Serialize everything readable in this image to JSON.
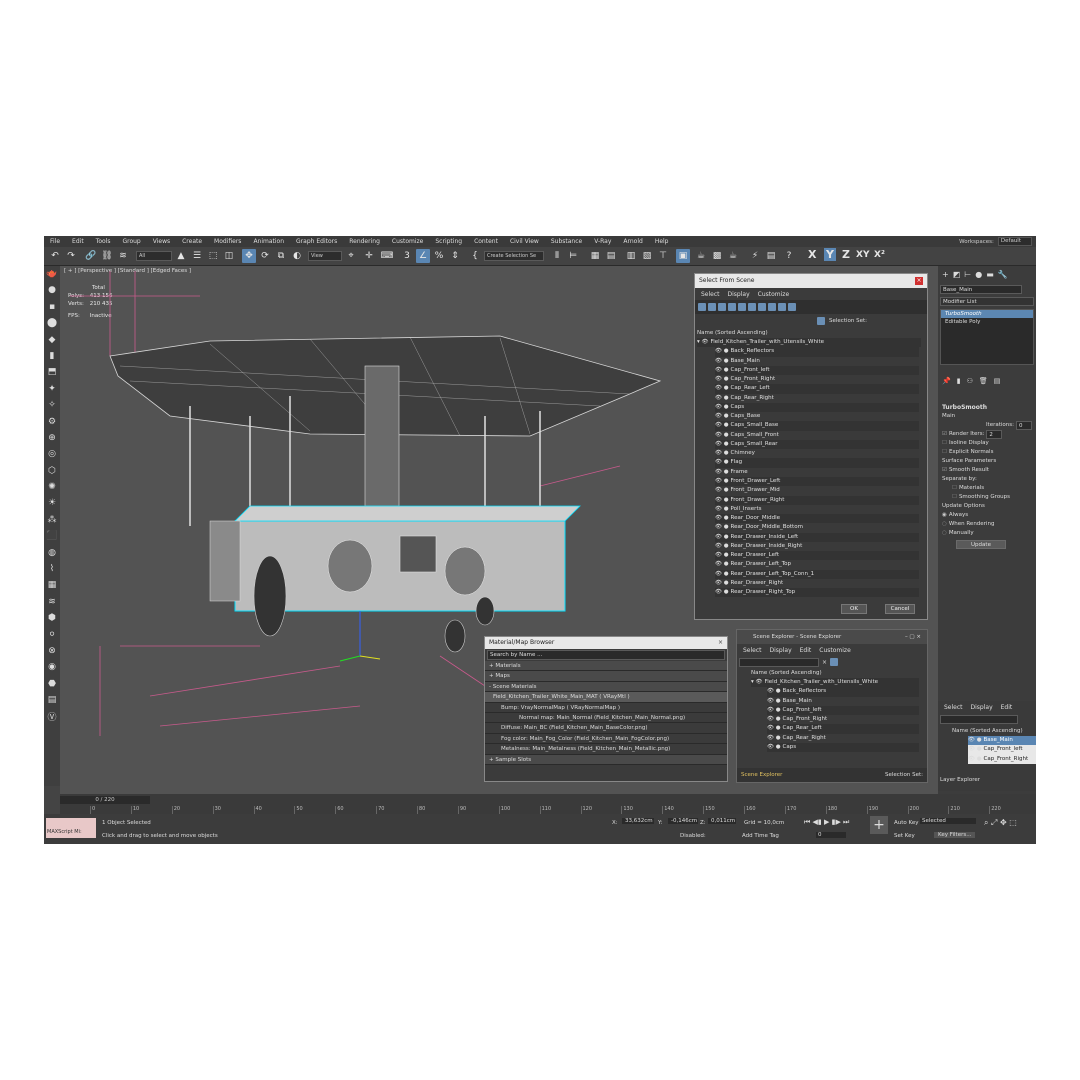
{
  "menu": [
    "File",
    "Edit",
    "Tools",
    "Group",
    "Views",
    "Create",
    "Modifiers",
    "Animation",
    "Graph Editors",
    "Rendering",
    "Customize",
    "Scripting",
    "Content",
    "Civil View",
    "Substance",
    "V-Ray",
    "Arnold",
    "Help"
  ],
  "workspace": {
    "label": "Workspaces:",
    "value": "Default"
  },
  "toolbar": {
    "filter": "All",
    "view": "View",
    "selection_set": "Create Selection Se",
    "axes": [
      "X",
      "Y",
      "Z",
      "XY",
      "X²"
    ]
  },
  "viewport": {
    "label": "[ + ] [Perspective ] [Standard ] [Edged Faces ]",
    "total": "Total",
    "polys_label": "Polys:",
    "polys": "413 156",
    "verts_label": "Verts:",
    "verts": "210 435",
    "fps_label": "FPS:",
    "fps": "Inactive"
  },
  "right_panel": {
    "object_name": "Base_Main",
    "modifier_list": "Modifier List",
    "stack": [
      "TurboSmooth",
      "Editable Poly"
    ],
    "turbosmooth": {
      "title": "TurboSmooth",
      "main": "Main",
      "iterations_label": "Iterations:",
      "iterations": "0",
      "render_iters_label": "Render Iters:",
      "render_iters": "2",
      "isoline": "Isoline Display",
      "explicit": "Explicit Normals",
      "surface": "Surface Parameters",
      "smooth": "Smooth Result",
      "separate": "Separate by:",
      "materials": "Materials",
      "smoothing": "Smoothing Groups",
      "update_opts": "Update Options",
      "always": "Always",
      "when_render": "When Rendering",
      "manually": "Manually",
      "update_btn": "Update"
    }
  },
  "select_from_scene": {
    "title": "Select From Scene",
    "menu": [
      "Select",
      "Display",
      "Customize"
    ],
    "selection_set": "Selection Set:",
    "header": "Name (Sorted Ascending)",
    "root": "Field_Kitchen_Trailer_with_Utensils_White",
    "items": [
      "Back_Reflectors",
      "Base_Main",
      "Cap_Front_left",
      "Cap_Front_Right",
      "Cap_Rear_Left",
      "Cap_Rear_Right",
      "Caps",
      "Caps_Base",
      "Caps_Small_Base",
      "Caps_Small_Front",
      "Caps_Small_Rear",
      "Chimney",
      "Flag",
      "Frame",
      "Front_Drawer_Left",
      "Front_Drawer_Mid",
      "Front_Drawer_Right",
      "Poll_Inserts",
      "Rear_Door_Middle",
      "Rear_Door_Middle_Bottom",
      "Rear_Drawer_Inside_Left",
      "Rear_Drawer_Inside_Right",
      "Rear_Drawer_Left",
      "Rear_Drawer_Left_Top",
      "Rear_Drawer_Left_Top_Conn_1",
      "Rear_Drawer_Right",
      "Rear_Drawer_Right_Top"
    ],
    "ok": "OK",
    "cancel": "Cancel"
  },
  "material_browser": {
    "title": "Material/Map Browser",
    "search": "Search by Name ...",
    "sections": [
      "+ Materials",
      "+ Maps",
      "- Scene Materials"
    ],
    "rows": [
      "Field_Kitchen_Trailer_White_Main_MAT  ( VRayMtl )",
      "Bump: VrayNormalMap  ( VRayNormalMap )",
      "Normal map: Main_Normal (Field_Kitchen_Main_Normal.png)",
      "Diffuse: Main_BC (Field_Kitchen_Main_BaseColor.png)",
      "Fog color: Main_Fog_Color (Field_Kitchen_Main_FogColor.png)",
      "Metalness: Main_Metalness (Field_Kitchen_Main_Metallic.png)"
    ],
    "sample": "+ Sample Slots"
  },
  "scene_explorer": {
    "title": "Scene Explorer - Scene Explorer",
    "menu": [
      "Select",
      "Display",
      "Edit",
      "Customize"
    ],
    "header": "Name (Sorted Ascending)",
    "root": "Field_Kitchen_Trailer_with_Utensils_White",
    "items": [
      "Back_Reflectors",
      "Base_Main",
      "Cap_Front_left",
      "Cap_Front_Right",
      "Cap_Rear_Left",
      "Cap_Rear_Right",
      "Caps"
    ],
    "footer_name": "Scene Explorer",
    "selection_set": "Selection Set:"
  },
  "layer_explorer": {
    "menu": [
      "Select",
      "Display",
      "Edit"
    ],
    "header": "Name (Sorted Ascending)",
    "items": [
      "Base_Main",
      "Cap_Front_left",
      "Cap_Front_Right"
    ],
    "footer": "Layer Explorer"
  },
  "timeline": {
    "frame": "0 / 220",
    "ticks": [
      "0",
      "10",
      "20",
      "30",
      "40",
      "50",
      "60",
      "70",
      "80",
      "90",
      "100",
      "110",
      "120",
      "130",
      "140",
      "150",
      "160",
      "170",
      "180",
      "190",
      "200",
      "210",
      "220"
    ]
  },
  "status": {
    "maxscript": "MAXScript Mi:",
    "selected": "1 Object Selected",
    "hint": "Click and drag to select and move objects",
    "x_label": "X:",
    "x": "33,632cm",
    "y_label": "Y:",
    "y": "-0,146cm",
    "z_label": "Z:",
    "z": "0,011cm",
    "grid": "Grid = 10,0cm",
    "disabled": "Disabled:",
    "add_time_tag": "Add Time Tag",
    "auto_key": "Auto Key",
    "selected_dd": "Selected",
    "set_key": "Set Key",
    "key_filters": "Key Filters...",
    "frame_field": "0"
  },
  "colors": {
    "accent": "#5a86b3",
    "selection": "#00e0ff",
    "app_bg": "#444444",
    "viewport_bg": "#535353"
  }
}
